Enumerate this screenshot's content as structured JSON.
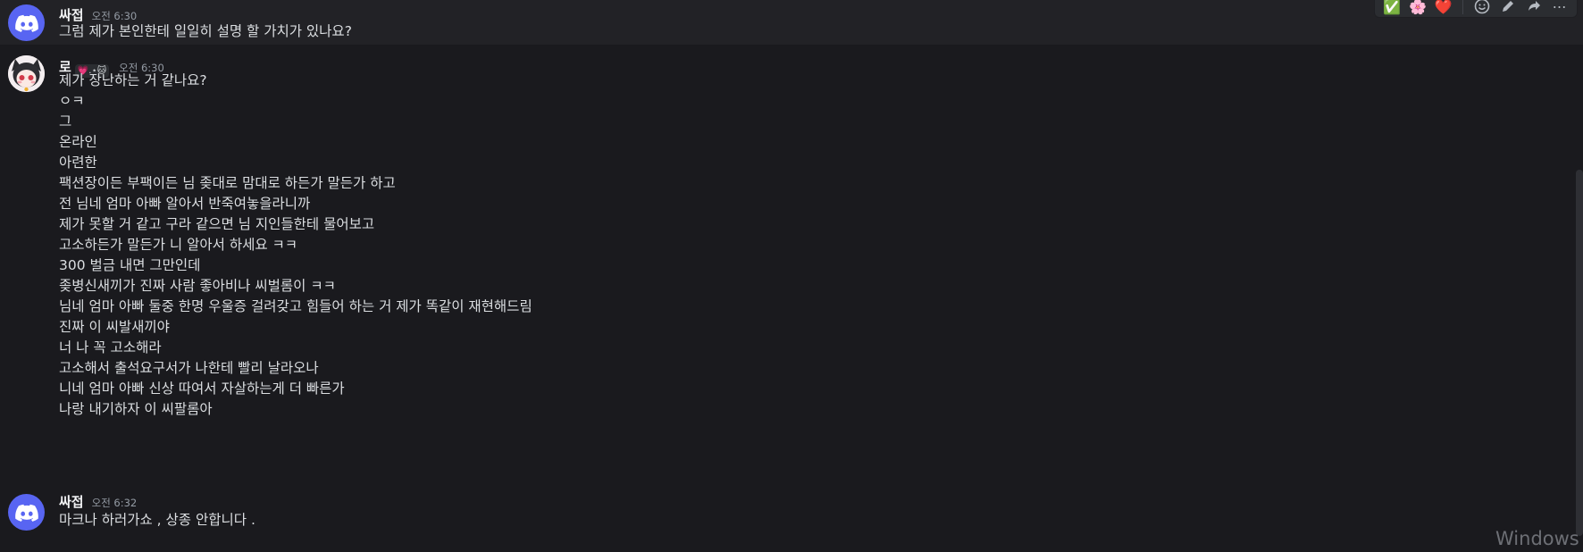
{
  "messages": [
    {
      "author": "싸접",
      "timestamp": "오전 6:30",
      "lines": [
        "그럼 제가 본인한테 일일히 설명 할 가치가 있나요?"
      ]
    },
    {
      "author": "로",
      "badge": "💗.⋆🐱",
      "timestamp": "오전 6:30",
      "lines": [
        "제가 장난하는 거 같나요?",
        "ㅇㅋ",
        "그",
        "온라인",
        "아련한",
        "팩션장이든 부팩이든 님 좆대로 맘대로 하든가 말든가 하고",
        "전 님네 엄마 아빠 알아서 반죽여놓을라니까",
        "제가 못할 거 같고 구라 같으면 님 지인들한테 물어보고",
        "고소하든가 말든가 니 알아서 하세요 ㅋㅋ",
        "300 벌금 내면 그만인데",
        "좆병신새끼가 진짜 사람 좋아비나 씨벌롬이 ㅋㅋ",
        "님네 엄마 아빠 둘중 한명 우울증 걸려갖고 힘들어 하는 거 제가 똑같이 재현해드림",
        "진짜 이 씨발새끼야",
        "너 나 꼭 고소해라",
        "고소해서 출석요구서가 나한테 빨리 날라오나",
        "니네 엄마 아빠 신상 따여서 자살하는게 더 빠른가",
        "나랑 내기하자 이 씨팔롬아"
      ]
    },
    {
      "author": "싸접",
      "timestamp": "오전 6:32",
      "lines": [
        "마크나 하러가쇼 , 상종 안합니다 ."
      ]
    }
  ],
  "toolbar": {
    "reactions": [
      "✅",
      "🌸",
      "❤️"
    ],
    "actions": [
      "add-reaction-icon",
      "edit-icon",
      "reply-icon",
      "more-icon"
    ],
    "more_label": "⋯"
  },
  "watermark": "Windows ?",
  "colors": {
    "background": "#1a1a1e",
    "hover": "#222226",
    "blurple": "#5865f2",
    "text": "#dbdee1",
    "muted": "#949ba4"
  }
}
